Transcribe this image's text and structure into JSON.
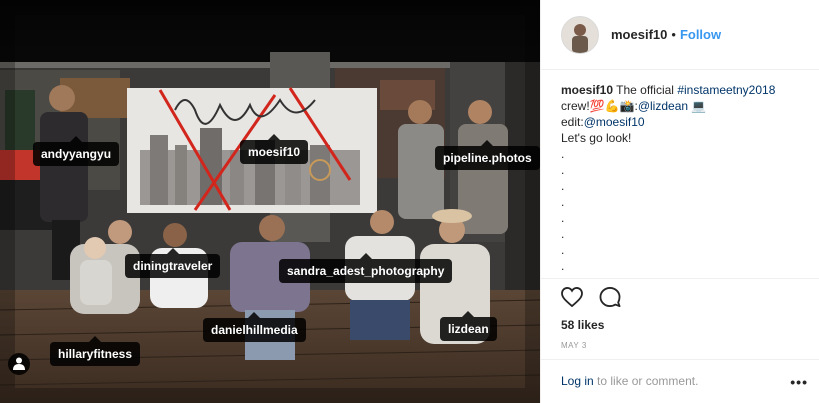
{
  "post": {
    "tags": [
      {
        "label": "andyyangyu"
      },
      {
        "label": "moesif10"
      },
      {
        "label": "pipeline.photos"
      },
      {
        "label": "diningtraveler"
      },
      {
        "label": "sandra_adest_photography"
      },
      {
        "label": "danielhillmedia"
      },
      {
        "label": "lizdean"
      },
      {
        "label": "hillaryfitness"
      }
    ]
  },
  "header": {
    "username": "moesif10",
    "separator": "•",
    "follow_label": "Follow"
  },
  "caption": {
    "username": "moesif10",
    "text_1": "The official",
    "hashtag": "#instameetny2018",
    "text_2": "crew!💯💪📸:",
    "mention_1": "@lizdean",
    "text_3": "💻",
    "edit_prefix": "edit:",
    "mention_2": "@moesif10",
    "line_last": "Let's go look!",
    "dots": [
      ".",
      ".",
      ".",
      ".",
      ".",
      ".",
      ".",
      "."
    ]
  },
  "actions": {
    "like_icon": "heart-icon",
    "comment_icon": "comment-icon",
    "likes_text": "58 likes",
    "date_text": "MAY 3"
  },
  "footer": {
    "login_link": "Log in",
    "login_suffix": " to like or comment.",
    "more_label": "•••"
  },
  "colors": {
    "accent": "#3897f0",
    "link": "#003569",
    "muted": "#999999",
    "border": "#efefef"
  }
}
